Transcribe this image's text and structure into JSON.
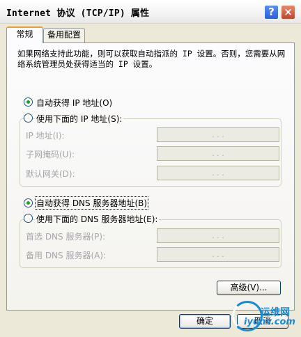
{
  "window": {
    "title": "Internet 协议 (TCP/IP) 属性",
    "help_label": "?",
    "close_label": "×"
  },
  "tabs": [
    {
      "label": "常规",
      "selected": true
    },
    {
      "label": "备用配置",
      "selected": false
    }
  ],
  "intro_text": "如果网络支持此功能，则可以获取自动指派的 IP 设置。否则，您需要从网络系统管理员处获得适当的 IP 设置。",
  "ip_section": {
    "auto_option": {
      "label": "自动获得 IP 地址(O)",
      "checked": true
    },
    "manual_option": {
      "label": "使用下面的 IP 地址(S):",
      "checked": false
    },
    "fields": [
      {
        "label": "IP 地址(I):",
        "value": ". . ."
      },
      {
        "label": "子网掩码(U):",
        "value": ". . ."
      },
      {
        "label": "默认网关(D):",
        "value": ". . ."
      }
    ]
  },
  "dns_section": {
    "auto_option": {
      "label": "自动获得 DNS 服务器地址(B)",
      "checked": true
    },
    "manual_option": {
      "label": "使用下面的 DNS 服务器地址(E):",
      "checked": false
    },
    "fields": [
      {
        "label": "首选 DNS 服务器(P):",
        "value": ". . ."
      },
      {
        "label": "备用 DNS 服务器(A):",
        "value": ". . ."
      }
    ]
  },
  "buttons": {
    "advanced": "高级(V)...",
    "ok": "确定",
    "cancel": "取消"
  },
  "watermark": {
    "line1": "运维网",
    "line2": "iyunv.com"
  },
  "colors": {
    "dialog_bg": "#ece9d8",
    "radio_dot": "#21a121",
    "disabled_text": "#a7a6aa",
    "watermark": "#1a8ad4"
  }
}
